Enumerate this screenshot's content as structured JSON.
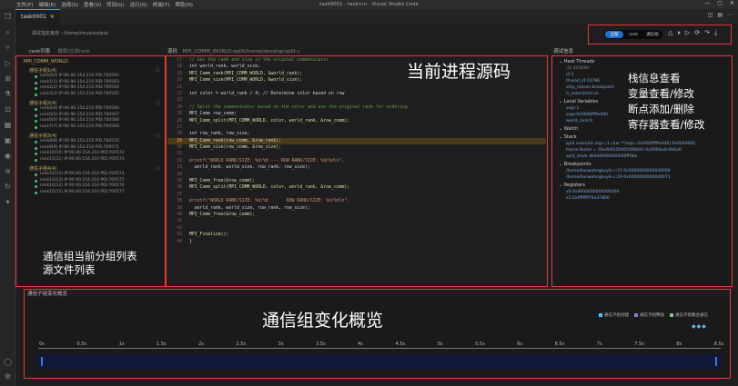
{
  "titlebar": {
    "menus": [
      "文件(F)",
      "编辑(E)",
      "选择(S)",
      "查看(V)",
      "转到(G)",
      "运行(R)",
      "终端(T)",
      "帮助(H)"
    ],
    "window_title": "task0001 - taskrun - Visual Studio Code"
  },
  "activity_icons": [
    "files-icon",
    "search-icon",
    "source-control-icon",
    "run-debug-icon",
    "extensions-icon",
    "flask-icon",
    "remote-icon",
    "grid-icon",
    "docker-icon",
    "eye-icon",
    "layers-icon",
    "refresh-icon",
    "sparkle-icon"
  ],
  "tab": {
    "label": "task0001",
    "close": "×"
  },
  "toolbar": {
    "connection": "调试指定来自 - /home/tmux/output",
    "modes": [
      "全部",
      "rank",
      "通信组"
    ]
  },
  "headers": {
    "rank": "rank列表",
    "rank_placeholder": "搜索/过滤rank",
    "source": "源码",
    "source_path": "MPI_COMM_WORLD-splitt/home/develop/split.c",
    "debug": "调试信息",
    "overview": "通信子组变化概览"
  },
  "rank_tree": {
    "root": "MPI_COMM_WORLD",
    "groups": [
      {
        "name": "通信子组1(4)",
        "ranks": [
          "rank0(0) IP:90.90.154.210 PID:700562",
          "rank1(1) IP:90.90.154.210 PID:700563",
          "rank2(2) IP:90.90.154.210 PID:700564",
          "rank3(3) IP:90.90.154.210 PID:700565"
        ]
      },
      {
        "name": "通信子组2(4)",
        "ranks": [
          "rank4(4) IP:90.90.154.210 PID:700566",
          "rank5(5) IP:90.90.154.210 PID:700567",
          "rank6(6) IP:90.90.154.210 PID:700568",
          "rank7(7) IP:90.90.154.210 PID:700569"
        ]
      },
      {
        "name": "通信子组3(4)",
        "ranks": [
          "rank8(8) IP:90.90.154.210 PID:700570",
          "rank9(9) IP:90.90.154.210 PID:700571",
          "rank10(10) IP:90.90.154.210 PID:700572",
          "rank11(11) IP:90.90.154.210 PID:700573"
        ]
      },
      {
        "name": "通信子组4(4)",
        "ranks": [
          "rank12(12) IP:90.90.154.210 PID:700574",
          "rank13(13) IP:90.90.154.210 PID:700575",
          "rank14(14) IP:90.90.154.210 PID:700576",
          "rank15(15) IP:90.90.154.210 PID:700577"
        ]
      }
    ]
  },
  "code": {
    "lines": [
      {
        "n": "17",
        "t": "// Get the rank and size in the original communicator",
        "k": "cm"
      },
      {
        "n": "18",
        "t": "int world_rank, world_size;",
        "k": ""
      },
      {
        "n": "19",
        "t": "MPI_Comm_rank(MPI_COMM_WORLD, &world_rank);",
        "k": "fn"
      },
      {
        "n": "20",
        "t": "MPI_Comm_size(MPI_COMM_WORLD, &world_size);",
        "k": "fn"
      },
      {
        "n": "21",
        "t": "",
        "k": ""
      },
      {
        "n": "22",
        "t": "int color = world_rank / 4; // Determine color based on row",
        "k": ""
      },
      {
        "n": "23",
        "t": "",
        "k": ""
      },
      {
        "n": "24",
        "t": "// Split the communicator based on the color and use the original rank for ordering",
        "k": "cm"
      },
      {
        "n": "25",
        "t": "MPI_Comm row_comm;",
        "k": ""
      },
      {
        "n": "26",
        "t": "MPI_Comm_split(MPI_COMM_WORLD, color, world_rank, &row_comm);",
        "k": "fn"
      },
      {
        "n": "27",
        "t": "",
        "k": ""
      },
      {
        "n": "28",
        "t": "int row_rank, row_size;",
        "k": ""
      },
      {
        "n": "29",
        "t": "MPI_Comm_rank(row_comm, &row_rank);",
        "k": "hl"
      },
      {
        "n": "30",
        "t": "MPI_Comm_size(row_comm, &row_size);",
        "k": "fn"
      },
      {
        "n": "31",
        "t": "",
        "k": ""
      },
      {
        "n": "32",
        "t": "printf(\"WORLD RANK/SIZE: %d/%d --- ROW RANK/SIZE: %d/%d\\n\",",
        "k": "st"
      },
      {
        "n": "33",
        "t": "  world_rank, world_size, row_rank, row_size);",
        "k": ""
      },
      {
        "n": "34",
        "t": "",
        "k": ""
      },
      {
        "n": "35",
        "t": "MPI_Comm_free(&row_comm);",
        "k": "fn"
      },
      {
        "n": "36",
        "t": "MPI_Comm_split(MPI_COMM_WORLD, color, world_rank, &row_comm);",
        "k": "fn"
      },
      {
        "n": "37",
        "t": "",
        "k": ""
      },
      {
        "n": "38",
        "t": "printf(\"WORLD RANK/SIZE: %d/%d       ROW RANK/SIZE: %d/%d\\n\",",
        "k": "st"
      },
      {
        "n": "39",
        "t": "  world_rank, world_size, row_rank, row_size);",
        "k": ""
      },
      {
        "n": "40",
        "t": "MPI_Comm_free(&row_comm);",
        "k": "fn"
      },
      {
        "n": "41",
        "t": "",
        "k": ""
      },
      {
        "n": "42",
        "t": "",
        "k": ""
      },
      {
        "n": "43",
        "t": "MPI_Finalize();",
        "k": "fn"
      },
      {
        "n": "44",
        "t": "}",
        "k": ""
      }
    ]
  },
  "debug": {
    "sections": [
      {
        "title": "Heat Threads",
        "items": [
          "(2) 4(2838)",
          "id:1",
          "thread_id:33796",
          "stop_reason:breakpoint",
          "is_selected:true"
        ]
      },
      {
        "title": "Local Variables",
        "items": [
          "argc:1",
          "argv:0x0000ffffe4d0",
          "world_rank:0"
        ]
      },
      {
        "title": "Watch",
        "items": []
      },
      {
        "title": "Stack",
        "items": [
          "split main(int argc=1 char **argv=0x0000ffffe4d0) 0x0000000",
          "frame Name = 10x4b9250005000b93 0x0000a4c4b6a9",
          "split_stack 4b9a0000000000fff0ba"
        ]
      },
      {
        "title": "Breakpoints",
        "items": [
          "/home/lianwohngkuyik.c:15 0x0000000000040000",
          "/home/lianwohngkuyik.c:29 0x0000000000040071"
        ]
      },
      {
        "title": "Registers",
        "items": [
          "x0:0x0000000000000000",
          "x1:0xffffffff74e37800"
        ]
      }
    ]
  },
  "overview": {
    "legend": [
      {
        "label": "通信子组创建",
        "color": "#4fc3f7"
      },
      {
        "label": "通信子组释放",
        "color": "#9575cd"
      },
      {
        "label": "通信子组集合通信",
        "color": "#81c784"
      }
    ],
    "ticks": [
      "0s",
      "0.5s",
      "1s",
      "1.5s",
      "2s",
      "2.5s",
      "3s",
      "3.5s",
      "4s",
      "4.5s",
      "5s",
      "5.5s",
      "6s",
      "6.5s",
      "7s",
      "7.5s",
      "8s",
      "8.5s"
    ],
    "diamonds": "◆◆◆"
  },
  "annotations": {
    "code": "当前进程源码",
    "debug": [
      "栈信息查看",
      "变量查看/修改",
      "断点添加/删除",
      "寄存器查看/修改"
    ],
    "rank": [
      "通信组当前分组列表",
      "源文件列表"
    ],
    "overview": "通信组变化概览"
  }
}
